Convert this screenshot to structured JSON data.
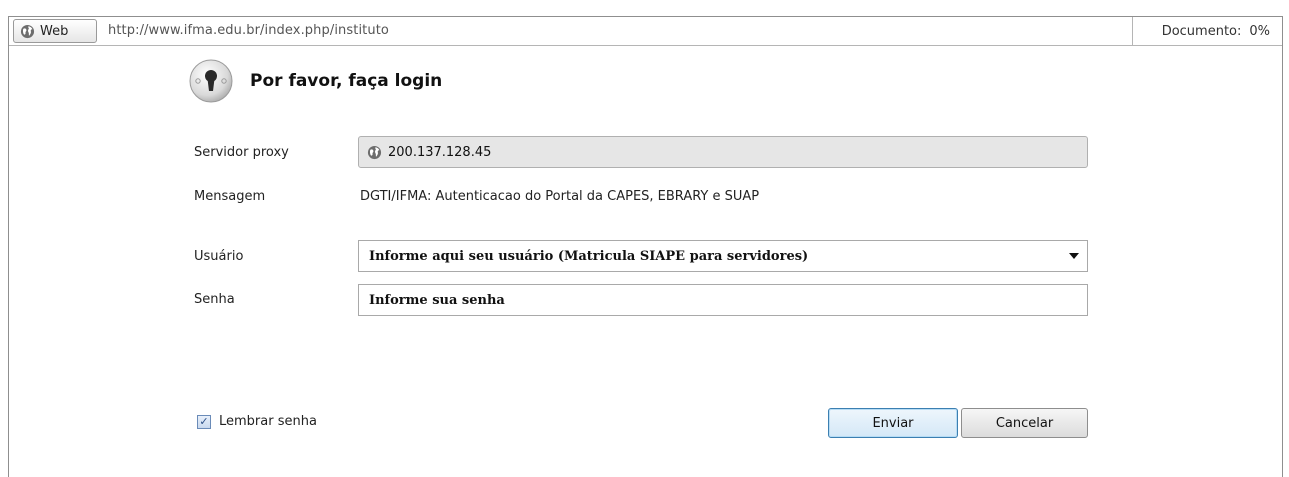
{
  "browser": {
    "web_label": "Web",
    "url": "http://www.ifma.edu.br/index.php/instituto",
    "status_label": "Documento:",
    "status_value": "0%"
  },
  "dialog": {
    "title": "Por favor, faça login",
    "proxy_label": "Servidor proxy",
    "proxy_value": "200.137.128.45",
    "message_label": "Mensagem",
    "message_value": "DGTI/IFMA: Autenticacao do Portal da CAPES, EBRARY e SUAP",
    "user_label": "Usuário",
    "user_value": "Informe aqui seu usuário (Matricula SIAPE para servidores)",
    "password_label": "Senha",
    "password_value": "Informe sua senha",
    "remember_label": "Lembrar senha",
    "remember_checked": true,
    "submit_label": "Enviar",
    "cancel_label": "Cancelar"
  },
  "icons": {
    "globe": "globe-icon",
    "keyhole": "keyhole-icon",
    "dropdown": "chevron-down-icon",
    "check": "checkmark-icon"
  }
}
